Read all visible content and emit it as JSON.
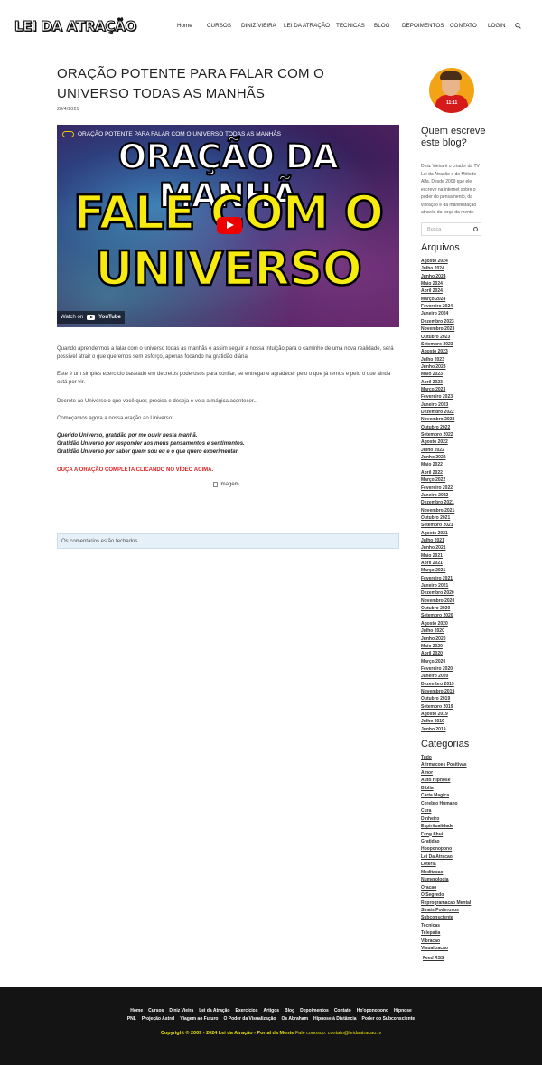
{
  "header": {
    "logo": "LEI DA ATRAÇÃO",
    "nav": [
      "Home",
      "CURSOS",
      "DINIZ VIEIRA",
      "LEI DA ATRAÇÃO",
      "TECNICAS",
      "BLOG",
      "DEPOIMENTOS",
      "CONTATO",
      "LOGIN"
    ],
    "search_icon": "search-icon"
  },
  "post": {
    "title": "ORAÇÃO POTENTE PARA FALAR COM O UNIVERSO TODAS AS MANHÃS",
    "date": "28/4/2021",
    "video": {
      "top_title": "ORAÇÃO POTENTE PARA FALAR COM O UNIVERSO TODAS AS MANHÃS",
      "line1": "ORAÇÃO DA MANHÃ",
      "line2": "FALE COM O",
      "line3": "UNIVERSO",
      "watch_on": "Watch on",
      "youtube": "YouTube"
    },
    "p1": "Quando aprendermos a falar com o universo todas as manhãs e assim seguir a nossa intuição para o caminho de uma nova realidade, será possível atrair o que queremos sem esforço, apenas focando na gratidão diária.",
    "p2": "Este é um simples exercício baseado em decretos poderosos para confiar, se entregar e agradecer pelo o que já temos e pelo o que ainda está por vir.",
    "p3": "Decrete ao Universo o que você quer, precisa e deseja e veja a mágica acontecer..",
    "p4": "Começamos agora a nossa oração ao Universo:",
    "prayer": [
      "Querido Universo, gratidão por me ouvir nesta manhã.",
      "Gratidão Universo por responder aos meus pensamentos e sentimentos.",
      "Gratidão Universo por saber quem sou eu e o que quero experimentar."
    ],
    "cta": "OUÇA A ORAÇÃO COMPLETA CLICANDO NO VÍDEO ACIMA.",
    "img_alt": "Imagem",
    "comments": "Os comentários estão fechados."
  },
  "sidebar": {
    "avatar_shirt": "11:11",
    "about_title": "Quem escreve este blog?",
    "about_text": "Diniz Vieira é o criador da TV Lei da Atração e do Método Alfa. Desde 2009 que ele escreve na internet sobre o poder do pensamento, da vibração e da manifestação através da força da mente.",
    "search_placeholder": "Busca",
    "archives_title": "Arquivos",
    "archives": [
      "Agosto 2024",
      "Julho 2024",
      "Junho 2024",
      "Maio 2024",
      "Abril 2024",
      "Março 2024",
      "Fevereiro 2024",
      "Janeiro 2024",
      "Dezembro 2023",
      "Novembro 2023",
      "Outubro 2023",
      "Setembro 2023",
      "Agosto 2023",
      "Julho 2023",
      "Junho 2023",
      "Maio 2023",
      "Abril 2023",
      "Março 2023",
      "Fevereiro 2023",
      "Janeiro 2023",
      "Dezembro 2022",
      "Novembro 2022",
      "Outubro 2022",
      "Setembro 2022",
      "Agosto 2022",
      "Julho 2022",
      "Junho 2022",
      "Maio 2022",
      "Abril 2022",
      "Março 2022",
      "Fevereiro 2022",
      "Janeiro 2022",
      "Dezembro 2021",
      "Novembro 2021",
      "Outubro 2021",
      "Setembro 2021",
      "Agosto 2021",
      "Julho 2021",
      "Junho 2021",
      "Maio 2021",
      "Abril 2021",
      "Março 2021",
      "Fevereiro 2021",
      "Janeiro 2021",
      "Dezembro 2020",
      "Novembro 2020",
      "Outubro 2020",
      "Setembro 2020",
      "Agosto 2020",
      "Julho 2020",
      "Junho 2020",
      "Maio 2020",
      "Abril 2020",
      "Março 2020",
      "Fevereiro 2020",
      "Janeiro 2020",
      "Dezembro 2019",
      "Novembro 2019",
      "Outubro 2019",
      "Setembro 2019",
      "Agosto 2019",
      "Julho 2019",
      "Junho 2019"
    ],
    "categories_title": "Categorias",
    "categories": [
      "Tudo",
      "Afirmacoes Positivas",
      "Amor",
      "Auto Hipnose",
      "Biblia",
      "Carta Magica",
      "Cerebro Humano",
      "Cura",
      "Dinheiro",
      "Espiritualidade",
      "Feng Shui",
      "Gratidao",
      "Hooponopono",
      "Lei Da Atracao",
      "Loteria",
      "Meditacao",
      "Numerologia",
      "Oracao",
      "O Segredo",
      "Reprogramacao Mental",
      "Sinais Poderosos",
      "Subconsciente",
      "Tecnicas",
      "Telepatia",
      "Vibracao",
      "Visualizacao"
    ],
    "feed": "Feed RSS"
  },
  "footer": {
    "row1": [
      "Home",
      "Cursos",
      "Diniz Vieira",
      "Lei da Atração",
      "Exercícios",
      "Artigos",
      "Blog",
      "Depoimentos",
      "Contato",
      "Ho'oponopono",
      "Hipnose"
    ],
    "row2": [
      "PNL",
      "Projeção Astral",
      "Viagem ao Futuro",
      "O Poder da Visualização",
      "Os Abraham",
      "Hipnose à Distância",
      "Poder do Subconsciente"
    ],
    "copyright": "Copyright © 2009 - 2024 Lei da Atração - Portal da Mente",
    "contact": "Fale conosco: contato@leidaatracao.tv"
  }
}
